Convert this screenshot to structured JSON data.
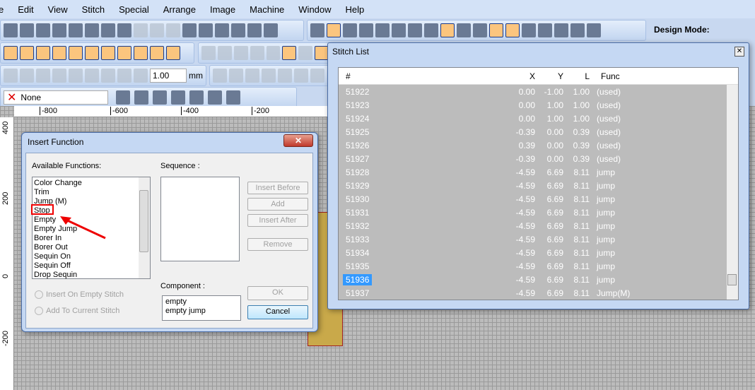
{
  "menu": [
    "e",
    "Edit",
    "View",
    "Stitch",
    "Special",
    "Arrange",
    "Image",
    "Machine",
    "Window",
    "Help"
  ],
  "toolbar": {
    "zoom_value": "1.00",
    "unit": "mm",
    "color_select": "None",
    "design_mode_label": "Design Mode:"
  },
  "ruler": {
    "h": [
      "-800",
      "-600",
      "-400",
      "-200"
    ],
    "v": [
      "400",
      "200",
      "0",
      "-200"
    ]
  },
  "insert_function": {
    "title": "Insert Function",
    "available_label": "Available Functions:",
    "functions": [
      "Color Change",
      "Trim",
      "Jump (M)",
      "Stop",
      "Empty",
      "Empty Jump",
      "Borer In",
      "Borer Out",
      "Sequin On",
      "Sequin Off",
      "Drop Sequin"
    ],
    "highlighted": "Stop",
    "sequence_label": "Sequence :",
    "buttons": {
      "insert_before": "Insert Before",
      "add": "Add",
      "insert_after": "Insert After",
      "remove": "Remove",
      "ok": "OK",
      "cancel": "Cancel"
    },
    "radio": {
      "insert_empty": "Insert On Empty Stitch",
      "add_current": "Add To Current Stitch"
    },
    "component_label": "Component :",
    "components": [
      "empty",
      "empty jump"
    ]
  },
  "stitch_list": {
    "title": "Stitch List",
    "columns": [
      "#",
      "X",
      "Y",
      "L",
      "Func"
    ],
    "selected": "51936",
    "rows": [
      [
        "51922",
        "0.00",
        "-1.00",
        "1.00",
        "(used)"
      ],
      [
        "51923",
        "0.00",
        "1.00",
        "1.00",
        "(used)"
      ],
      [
        "51924",
        "0.00",
        "1.00",
        "1.00",
        "(used)"
      ],
      [
        "51925",
        "-0.39",
        "0.00",
        "0.39",
        "(used)"
      ],
      [
        "51926",
        "0.39",
        "0.00",
        "0.39",
        "(used)"
      ],
      [
        "51927",
        "-0.39",
        "0.00",
        "0.39",
        "(used)"
      ],
      [
        "51928",
        "-4.59",
        "6.69",
        "8.11",
        "jump"
      ],
      [
        "51929",
        "-4.59",
        "6.69",
        "8.11",
        "jump"
      ],
      [
        "51930",
        "-4.59",
        "6.69",
        "8.11",
        "jump"
      ],
      [
        "51931",
        "-4.59",
        "6.69",
        "8.11",
        "jump"
      ],
      [
        "51932",
        "-4.59",
        "6.69",
        "8.11",
        "jump"
      ],
      [
        "51933",
        "-4.59",
        "6.69",
        "8.11",
        "jump"
      ],
      [
        "51934",
        "-4.59",
        "6.69",
        "8.11",
        "jump"
      ],
      [
        "51935",
        "-4.59",
        "6.69",
        "8.11",
        "jump"
      ],
      [
        "51936",
        "-4.59",
        "6.69",
        "8.11",
        "jump"
      ],
      [
        "51937",
        "-4.59",
        "6.69",
        "8.11",
        "Jump(M)"
      ]
    ]
  }
}
